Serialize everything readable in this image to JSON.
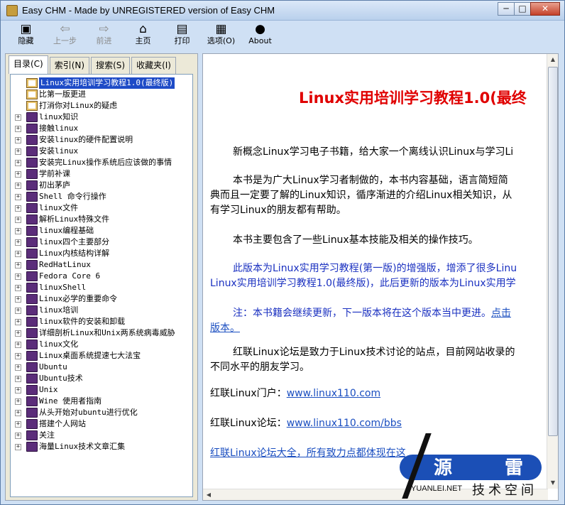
{
  "window": {
    "title": "Easy CHM - Made by UNREGISTERED version of Easy CHM",
    "minimize": "─",
    "maximize": "□",
    "close": "✕"
  },
  "toolbar": [
    {
      "label": "隐藏",
      "icon": "hide-icon",
      "glyph": "▣"
    },
    {
      "label": "上一步",
      "icon": "back-arrow-icon",
      "glyph": "⇦"
    },
    {
      "label": "前进",
      "icon": "forward-arrow-icon",
      "glyph": "⇨"
    },
    {
      "label": "主页",
      "icon": "home-icon",
      "glyph": "⌂"
    },
    {
      "label": "打印",
      "icon": "print-icon",
      "glyph": "▤"
    },
    {
      "label": "选项(O)",
      "icon": "options-icon",
      "glyph": "▦"
    },
    {
      "label": "About",
      "icon": "about-icon",
      "glyph": "●"
    }
  ],
  "tabs": [
    "目录(C)",
    "索引(N)",
    "搜索(S)",
    "收藏夹(I)"
  ],
  "tree": [
    {
      "label": "Linux实用培训学习教程1.0(最终版)",
      "expandable": false,
      "book": "open",
      "selected": true
    },
    {
      "label": "比第一版更进",
      "expandable": false,
      "book": "open",
      "selected": false
    },
    {
      "label": "打消你对Linux的疑虑",
      "expandable": false,
      "book": "open",
      "selected": false
    },
    {
      "label": "linux知识",
      "expandable": true,
      "book": "closed",
      "selected": false
    },
    {
      "label": "接触linux",
      "expandable": true,
      "book": "closed",
      "selected": false
    },
    {
      "label": "安装linux的硬件配置说明",
      "expandable": true,
      "book": "closed",
      "selected": false
    },
    {
      "label": "安装linux",
      "expandable": true,
      "book": "closed",
      "selected": false
    },
    {
      "label": "安装完Linux操作系统后应该做的事情",
      "expandable": true,
      "book": "closed",
      "selected": false
    },
    {
      "label": "学前补课",
      "expandable": true,
      "book": "closed",
      "selected": false
    },
    {
      "label": "初出茅庐",
      "expandable": true,
      "book": "closed",
      "selected": false
    },
    {
      "label": "Shell 命令行操作",
      "expandable": true,
      "book": "closed",
      "selected": false
    },
    {
      "label": "linux文件",
      "expandable": true,
      "book": "closed",
      "selected": false
    },
    {
      "label": "解析Linux特殊文件",
      "expandable": true,
      "book": "closed",
      "selected": false
    },
    {
      "label": "linux编程基础",
      "expandable": true,
      "book": "closed",
      "selected": false
    },
    {
      "label": "linux四个主要部分",
      "expandable": true,
      "book": "closed",
      "selected": false
    },
    {
      "label": "Linux内核结构详解",
      "expandable": true,
      "book": "closed",
      "selected": false
    },
    {
      "label": "RedHatLinux",
      "expandable": true,
      "book": "closed",
      "selected": false
    },
    {
      "label": "Fedora Core 6",
      "expandable": true,
      "book": "closed",
      "selected": false
    },
    {
      "label": "linuxShell",
      "expandable": true,
      "book": "closed",
      "selected": false
    },
    {
      "label": "Linux必学的重要命令",
      "expandable": true,
      "book": "closed",
      "selected": false
    },
    {
      "label": "linux培训",
      "expandable": true,
      "book": "closed",
      "selected": false
    },
    {
      "label": "linux软件的安装和卸载",
      "expandable": true,
      "book": "closed",
      "selected": false
    },
    {
      "label": "详细剖析Linux和Unix两系统病毒威胁",
      "expandable": true,
      "book": "closed",
      "selected": false
    },
    {
      "label": "linux文化",
      "expandable": true,
      "book": "closed",
      "selected": false
    },
    {
      "label": "Linux桌面系统提速七大法宝",
      "expandable": true,
      "book": "closed",
      "selected": false
    },
    {
      "label": "Ubuntu",
      "expandable": true,
      "book": "closed",
      "selected": false
    },
    {
      "label": "Ubuntu技术",
      "expandable": true,
      "book": "closed",
      "selected": false
    },
    {
      "label": "Unix",
      "expandable": true,
      "book": "closed",
      "selected": false
    },
    {
      "label": "Wine 使用者指南",
      "expandable": true,
      "book": "closed",
      "selected": false
    },
    {
      "label": "从头开始对ubuntu进行优化",
      "expandable": true,
      "book": "closed",
      "selected": false
    },
    {
      "label": "搭建个人网站",
      "expandable": true,
      "book": "closed",
      "selected": false
    },
    {
      "label": "关注",
      "expandable": true,
      "book": "closed",
      "selected": false
    },
    {
      "label": "海量Linux技术文章汇集",
      "expandable": true,
      "book": "closed",
      "selected": false
    }
  ],
  "content": {
    "heading": "Linux实用培训学习教程1.0(最终",
    "p1": "新概念Linux学习电子书籍，给大家一个离线认识Linux与学习Li",
    "p2a": "本书是为广大Linux学习者制做的，本书内容基础，语言简短简",
    "p2b": "典而且一定要了解的Linux知识，循序渐进的介绍Linux相关知识，从",
    "p2c": "有学习Linux的朋友都有帮助。",
    "p3": "本书主要包含了一些Linux基本技能及相关的操作技巧。",
    "p4a": "此版本为Linux实用学习教程(第一版)的增强版，增添了很多Linu",
    "p4b": "Linux实用培训学习教程1.0(最终版)，此后更新的版本为Linux实用学",
    "p5a": "注：本书籍会继续更新，下一版本将在这个版本当中更进。",
    "p5link": "点击",
    "p5b": "版本。",
    "p6a": "红联Linux论坛是致力于Linux技术讨论的站点，目前网站收录的",
    "p6b": "不同水平的朋友学习。",
    "portal_label": "红联Linux门户：",
    "portal_link": "www.linux110.com",
    "forum_label": "红联Linux论坛：",
    "forum_link": "www.linux110.com/bbs",
    "forum_all": "红联Linux论坛大全，所有致力点都体现在这"
  },
  "watermark": {
    "char1": "源",
    "char2": "雷",
    "domain": "YUANLEI.NET",
    "sub": "技术空间"
  }
}
